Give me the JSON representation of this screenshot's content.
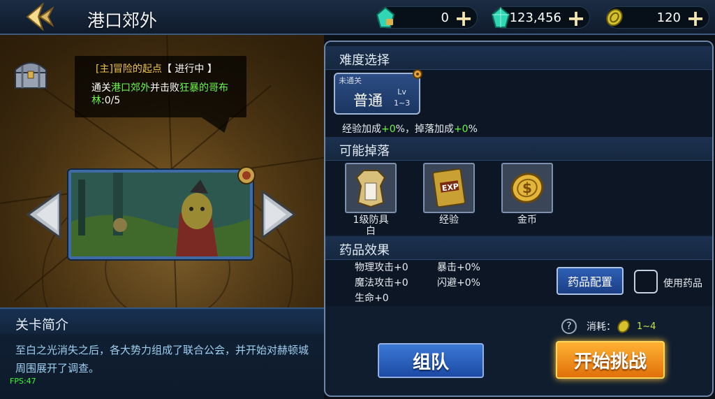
{
  "header": {
    "title": "港口郊外",
    "currencies": [
      {
        "icon": "green-crystal-lock-icon",
        "value": "0"
      },
      {
        "icon": "green-crystal-icon",
        "value": "123,456"
      },
      {
        "icon": "gold-coin-icon",
        "value": "120"
      }
    ],
    "plus_symbol": "+"
  },
  "quest": {
    "tag": "[主]冒险的起点",
    "status": "【 进行中 】",
    "desc_prefix": "通关",
    "desc_location": "港口郊外",
    "desc_mid": "并击败",
    "desc_target": "狂暴的哥布林",
    "desc_progress": ":0/5"
  },
  "intro": {
    "title": "关卡简介",
    "text": "至白之光消失之后，各大势力组成了联合公会，并开始对赫顿城周围展开了调查。",
    "fps": "FPS:47"
  },
  "difficulty": {
    "title": "难度选择",
    "lock_label": "未通关",
    "name": "普通",
    "lv_label": "Lv",
    "lv_range": "1~3",
    "bonus_exp": "经验加成",
    "bonus_exp_val": "+0",
    "bonus_sep": "%，掉落加成",
    "bonus_drop_val": "+0",
    "bonus_end": "%"
  },
  "drops": {
    "title": "可能掉落",
    "items": [
      {
        "label": "1级防具\n白",
        "icon": "armor-icon"
      },
      {
        "label": "经验",
        "icon": "exp-book-icon"
      },
      {
        "label": "金币",
        "icon": "gold-coin-icon"
      }
    ]
  },
  "potion": {
    "title": "药品效果",
    "stats": [
      "物理攻击+0",
      "暴击+0%",
      "魔法攻击+0",
      "闪避+0%",
      "生命+0"
    ],
    "config_button": "药品配置",
    "use_label": "使用药品"
  },
  "cost": {
    "label": "消耗：",
    "range": "1~4"
  },
  "buttons": {
    "team": "组队",
    "start": "开始挑战"
  },
  "colors": {
    "accent_gold": "#f0c64a",
    "highlight_green": "#6cf54a",
    "start_orange": "#ff9a1f",
    "team_blue": "#2a63c4"
  }
}
